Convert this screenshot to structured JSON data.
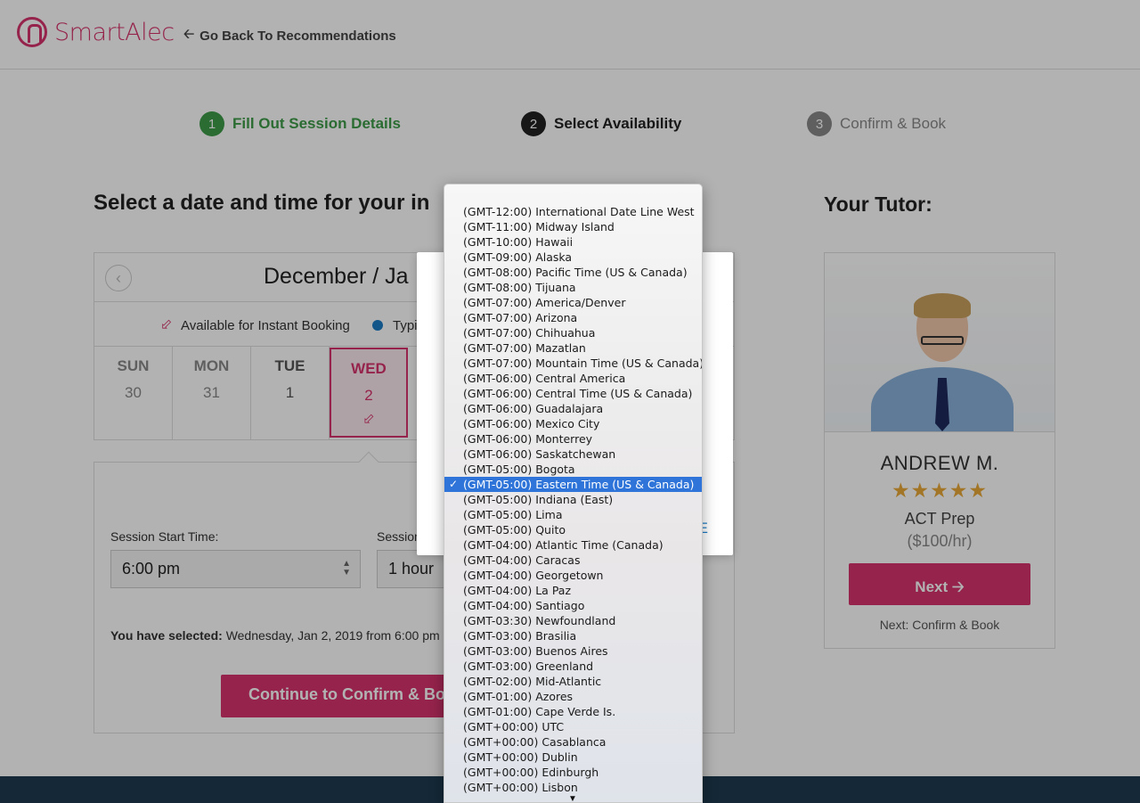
{
  "header": {
    "logo_text": "SmartAlec",
    "back_link": "Go Back To Recommendations"
  },
  "steps": [
    {
      "num": "1",
      "label": "Fill Out Session Details"
    },
    {
      "num": "2",
      "label": "Select Availability"
    },
    {
      "num": "3",
      "label": "Confirm & Book"
    }
  ],
  "main": {
    "title": "Select a date and time for your in",
    "calendar": {
      "month": "December / Ja",
      "legend_instant": "Available for Instant Booking",
      "legend_typical": "Typic",
      "days": [
        {
          "name": "SUN",
          "num": "30"
        },
        {
          "name": "MON",
          "num": "31"
        },
        {
          "name": "TUE",
          "num": "1"
        },
        {
          "name": "WED",
          "num": "2"
        }
      ]
    },
    "session": {
      "start_label": "Session Start Time:",
      "start_value": "6:00 pm",
      "length_label": "Session",
      "length_value": "1 hour",
      "selected_prefix": "You have selected:",
      "selected_value": "Wednesday, Jan 2, 2019 from 6:00 pm",
      "continue_label": "Continue to Confirm & Bo"
    }
  },
  "tutor": {
    "heading": "Your Tutor:",
    "name": "ANDREW M.",
    "stars": "★★★★★",
    "subject": "ACT Prep",
    "rate": "($100/hr)",
    "next_label": "Next",
    "next_note": "Next: Confirm & Book"
  },
  "modal": {
    "action_fragment": "E"
  },
  "timezone_dropdown": {
    "selected_index": 18,
    "options": [
      "(GMT-12:00) International Date Line West",
      "(GMT-11:00) Midway Island",
      "(GMT-10:00) Hawaii",
      "(GMT-09:00) Alaska",
      "(GMT-08:00) Pacific Time (US & Canada)",
      "(GMT-08:00) Tijuana",
      "(GMT-07:00) America/Denver",
      "(GMT-07:00) Arizona",
      "(GMT-07:00) Chihuahua",
      "(GMT-07:00) Mazatlan",
      "(GMT-07:00) Mountain Time (US & Canada)",
      "(GMT-06:00) Central America",
      "(GMT-06:00) Central Time (US & Canada)",
      "(GMT-06:00) Guadalajara",
      "(GMT-06:00) Mexico City",
      "(GMT-06:00) Monterrey",
      "(GMT-06:00) Saskatchewan",
      "(GMT-05:00) Bogota",
      "(GMT-05:00) Eastern Time (US & Canada)",
      "(GMT-05:00) Indiana (East)",
      "(GMT-05:00) Lima",
      "(GMT-05:00) Quito",
      "(GMT-04:00) Atlantic Time (Canada)",
      "(GMT-04:00) Caracas",
      "(GMT-04:00) Georgetown",
      "(GMT-04:00) La Paz",
      "(GMT-04:00) Santiago",
      "(GMT-03:30) Newfoundland",
      "(GMT-03:00) Brasilia",
      "(GMT-03:00) Buenos Aires",
      "(GMT-03:00) Greenland",
      "(GMT-02:00) Mid-Atlantic",
      "(GMT-01:00) Azores",
      "(GMT-01:00) Cape Verde Is.",
      "(GMT+00:00) UTC",
      "(GMT+00:00) Casablanca",
      "(GMT+00:00) Dublin",
      "(GMT+00:00) Edinburgh",
      "(GMT+00:00) Lisbon"
    ]
  },
  "colors": {
    "brand": "#d6336c",
    "step_done": "#3e9b4a",
    "selection": "#2f74d8",
    "footer": "#1d3a4f"
  }
}
